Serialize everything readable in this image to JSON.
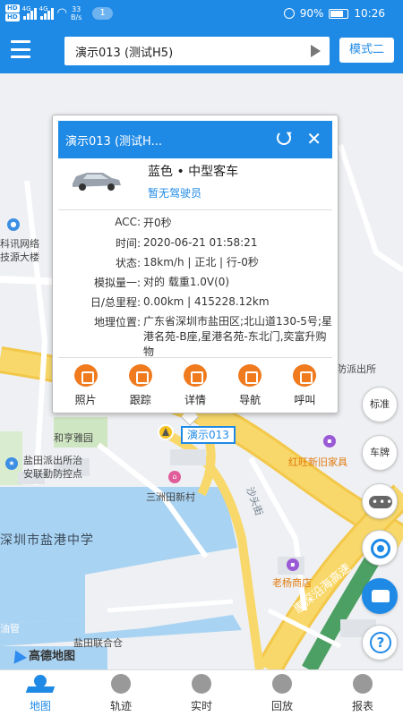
{
  "status_bar": {
    "hd1": "HD",
    "hd2": "HD",
    "sig1": "4G",
    "sig2": "4G",
    "speed_value": "33",
    "speed_unit": "B/s",
    "notification_count": "1",
    "battery": "90%",
    "time": "10:26"
  },
  "header": {
    "search_value": "演示013 (测试H5)",
    "mode_button": "模式二"
  },
  "popup": {
    "title": "演示013 (测试H...",
    "vehicle_type": "蓝色 • 中型客车",
    "driver": "暂无驾驶员",
    "rows": [
      {
        "label": "ACC:",
        "value": "开0秒"
      },
      {
        "label": "时间:",
        "value": "2020-06-21 01:58:21"
      },
      {
        "label": "状态:",
        "value": "18km/h | 正北 | 行-0秒"
      },
      {
        "label": "模拟量一:",
        "value": "对的 载重1.0V(0)"
      },
      {
        "label": "日/总里程:",
        "value": "0.00km | 415228.12km"
      },
      {
        "label": "地理位置:",
        "value": "广东省深圳市盐田区;北山道130-5号;星港名苑-B座,星港名苑-东北门,奕富升购物"
      }
    ],
    "actions": [
      {
        "label": "照片",
        "icon": "camera-icon"
      },
      {
        "label": "跟踪",
        "icon": "track-icon"
      },
      {
        "label": "详情",
        "icon": "list-icon"
      },
      {
        "label": "导航",
        "icon": "navigation-icon"
      },
      {
        "label": "呼叫",
        "icon": "phone-icon"
      }
    ]
  },
  "map": {
    "labels": {
      "l1": "科讯网络",
      "l2": "技源大楼",
      "l3": "和亨雅园",
      "l4": "盐田派出所治",
      "l5": "安联勤防控点",
      "l6": "三洲田新村",
      "l7": "深圳市盐港中学",
      "l8": "红旺新旧家具",
      "l9": "沙头街",
      "l10": "老杨商店",
      "l11": "防派出所",
      "l12": "盐田联合仓",
      "l13": "油管",
      "l14": "惠深沿海高速"
    },
    "vehicle_marker_label": "演示013",
    "logo": "高德地图"
  },
  "controls": {
    "standard": "标准",
    "plate": "车牌",
    "help": "?"
  },
  "bottom_nav": [
    {
      "label": "地图",
      "active": true
    },
    {
      "label": "轨迹",
      "active": false
    },
    {
      "label": "实时",
      "active": false
    },
    {
      "label": "回放",
      "active": false
    },
    {
      "label": "报表",
      "active": false
    }
  ],
  "colors": {
    "primary": "#1f8ae6",
    "action_orange": "#f07a1e",
    "road_yellow": "#f8d86a",
    "water": "#a9d3f2"
  }
}
